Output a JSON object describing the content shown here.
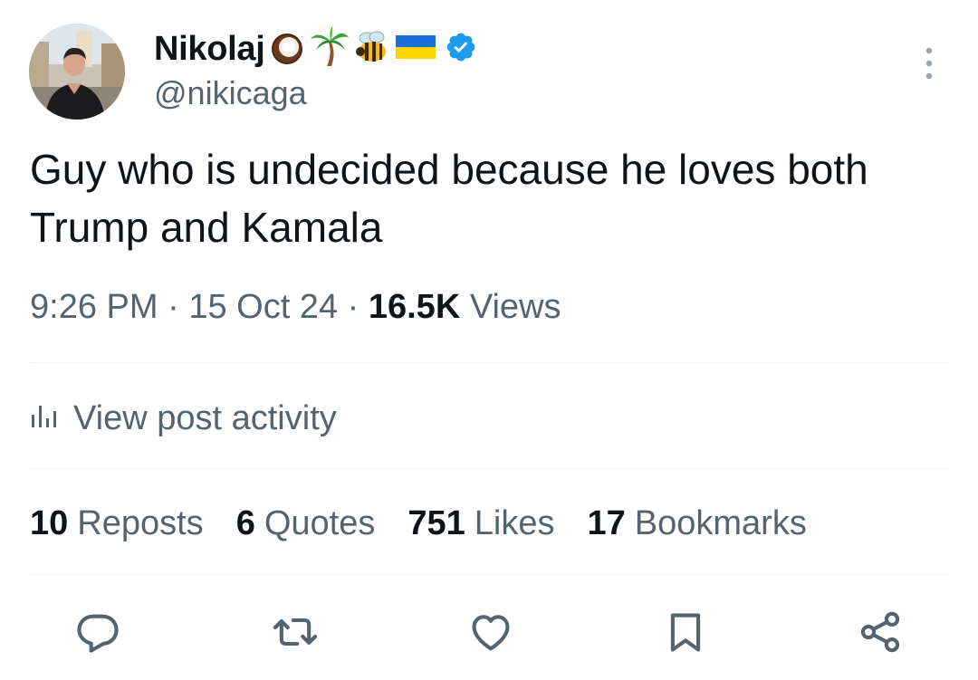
{
  "user": {
    "display_name": "Nikolaj",
    "emojis": [
      "coconut-icon",
      "palm-tree-icon",
      "bee-icon",
      "ukraine-flag-icon"
    ],
    "verified": true,
    "handle": "@nikicaga"
  },
  "post": {
    "text": "Guy who is undecided because he loves both Trump and Kamala",
    "time": "9:26 PM",
    "separator": "·",
    "date": "15 Oct 24",
    "views_count": "16.5K",
    "views_label": "Views"
  },
  "activity": {
    "label": "View post activity",
    "icon": "bar-chart-icon"
  },
  "stats": {
    "reposts": {
      "count": "10",
      "label": "Reposts"
    },
    "quotes": {
      "count": "6",
      "label": "Quotes"
    },
    "likes": {
      "count": "751",
      "label": "Likes"
    },
    "bookmarks": {
      "count": "17",
      "label": "Bookmarks"
    }
  },
  "actions": [
    "reply-icon",
    "repost-icon",
    "like-icon",
    "bookmark-icon",
    "share-icon"
  ],
  "colors": {
    "text": "#0f1419",
    "secondary": "#536471",
    "divider": "#eff3f4",
    "verified": "#1d9bf0"
  }
}
